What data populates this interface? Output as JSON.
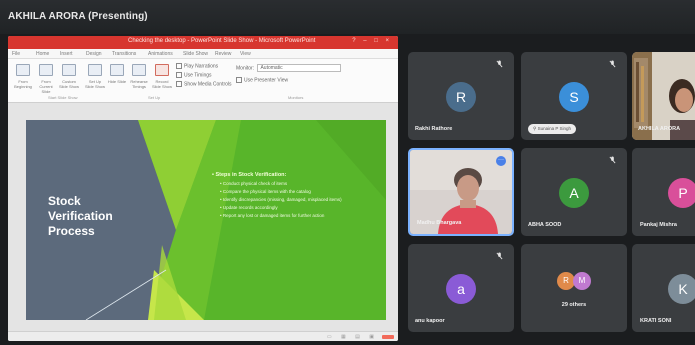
{
  "presenter_banner": {
    "label": "AKHILA ARORA (Presenting)"
  },
  "presentation": {
    "window_title": "Checking the desktop - PowerPoint Slide Show - Microsoft PowerPoint",
    "window_controls": "?  –  □  ×",
    "tabs": [
      "File",
      "Home",
      "Insert",
      "Design",
      "Transitions",
      "Animations",
      "Slide Show",
      "Review",
      "View"
    ],
    "ribbon": {
      "buttons": [
        "From Beginning",
        "From Current Slide",
        "Custom Slide Show",
        "Set Up Slide Show",
        "Hide Slide",
        "Rehearse Timings",
        "Record Slide Show"
      ],
      "checks": [
        "Play Narrations",
        "Use Timings",
        "Show Media Controls"
      ],
      "monitor_label": "Monitor:",
      "monitor_value": "Automatic",
      "presenter_view_label": "Use Presenter View",
      "group_labels": [
        "Start Slide Show",
        "Set Up",
        "Monitors"
      ]
    },
    "slide": {
      "title": "Stock Verification Process",
      "heading": "Steps in Stock Verification:",
      "bullets": [
        "Conduct physical check of items",
        "Compare the physical items with the catalog",
        "Identify discrepancies (missing, damaged, misplaced items)",
        "Update records accordingly",
        "Report any lost or damaged items for further action"
      ],
      "colors": {
        "background": "#5c6a7c",
        "green_primary": "#5cb82a",
        "green_light": "#b5e03a"
      }
    }
  },
  "participants": [
    {
      "name": "Rakhi Rathore",
      "initial": "R",
      "avatar_color": "#4a6d8c",
      "muted": true
    },
    {
      "name": "Sunaina P Singh",
      "initial": "S",
      "avatar_color": "#3b8fd9",
      "muted": true,
      "pinned_badge": true
    },
    {
      "name": "AKHILA ARORA",
      "video": true
    },
    {
      "name": "Madhu Bhargava",
      "video": true,
      "speaking": true
    },
    {
      "name": "ABHA SOOD",
      "initial": "A",
      "avatar_color": "#3c9a3e",
      "muted": true
    },
    {
      "name": "Pankaj Mishra",
      "initial": "P",
      "avatar_color": "#d94f9a"
    },
    {
      "name": "anu kapoor",
      "initial": "a",
      "avatar_color": "#8a5bd6",
      "muted": true
    },
    {
      "name": "29 others",
      "initials": [
        "R",
        "M"
      ],
      "avatar_colors": [
        "#e08a4a",
        "#c07ad0"
      ]
    },
    {
      "name": "KRATI SONI",
      "initial": "K",
      "avatar_color": "#7d8d99"
    }
  ]
}
